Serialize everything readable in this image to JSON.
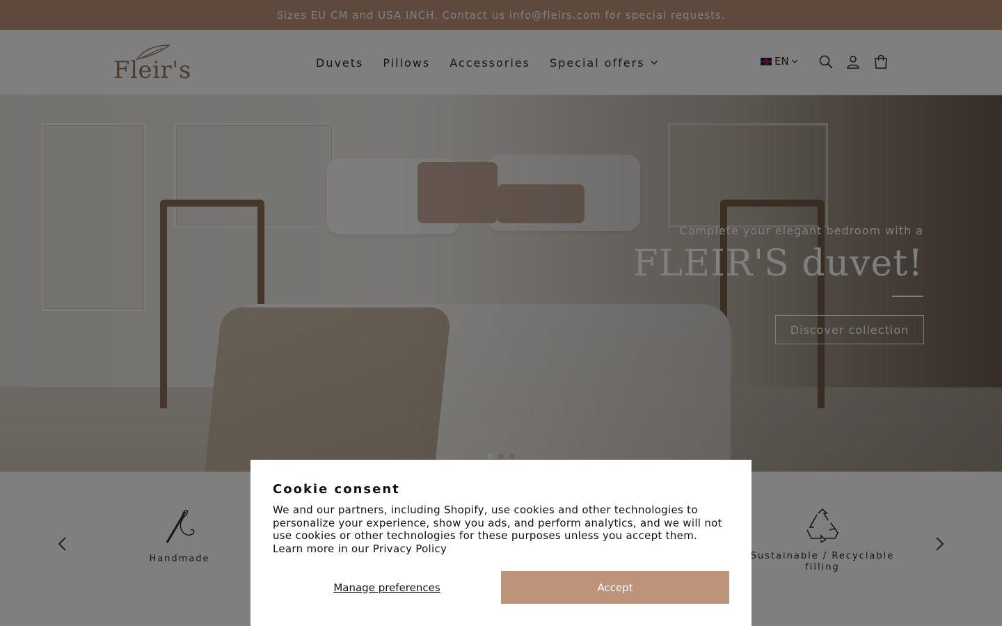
{
  "announcement": {
    "text": "Sizes EU CM and USA INCH. Contact us info@fleirs.com for special requests."
  },
  "header": {
    "logo_text": "Fleir's",
    "nav": [
      {
        "label": "Duvets"
      },
      {
        "label": "Pillows"
      },
      {
        "label": "Accessories"
      },
      {
        "label": "Special offers",
        "has_dropdown": true
      }
    ],
    "language": "EN",
    "icons": [
      "search-icon",
      "account-icon",
      "cart-icon"
    ]
  },
  "hero": {
    "subtitle": "Complete your elegant bedroom with a",
    "title": "FLEIR'S duvet!",
    "button_label": "Discover collection",
    "slides": 3,
    "active_slide": 1
  },
  "features": {
    "items": [
      {
        "label": "Handmade",
        "icon": "needle-thread-icon"
      },
      {
        "label": "Sustainable / Recyclable filling",
        "icon": "recycle-icon"
      }
    ]
  },
  "cookie": {
    "title": "Cookie consent",
    "body": "We and our partners, including Shopify, use cookies and other technologies to personalize your experience, show you ads, and perform analytics, and we will not use cookies or other technologies for these purposes unless you accept them.",
    "link_text": "Learn more in our Privacy Policy",
    "manage_label": "Manage preferences",
    "accept_label": "Accept"
  },
  "colors": {
    "brand": "#bd9379",
    "overlay": "rgba(0,0,0,0.5)"
  }
}
